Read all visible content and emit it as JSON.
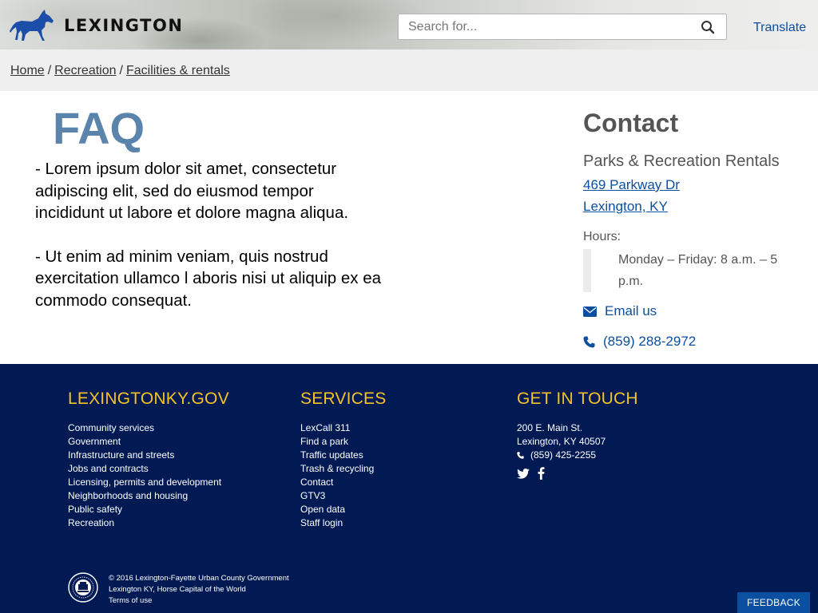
{
  "header": {
    "logo_text": "LEXINGTON",
    "search_placeholder": "Search for...",
    "translate_label": "Translate"
  },
  "breadcrumb": {
    "items": [
      "Home",
      "Recreation",
      "Facilities & rentals"
    ],
    "separator": "/"
  },
  "faq": {
    "title": "FAQ",
    "paragraphs": [
      "- Lorem ipsum dolor sit amet, consectetur adipiscing elit, sed do eiusmod tempor incididunt ut labore et dolore magna aliqua.",
      "- Ut enim ad minim veniam, quis nostrud exercitation ullamco l aboris nisi ut aliquip ex ea commodo consequat."
    ]
  },
  "contact": {
    "title": "Contact",
    "org": "Parks & Recreation Rentals",
    "address_line1": "469 Parkway Dr",
    "address_line2": "Lexington, KY",
    "hours_label": "Hours:",
    "hours_value": "Monday – Friday: 8 a.m. – 5 p.m.",
    "email_label": "Email us",
    "phone": "(859) 288-2972"
  },
  "footer": {
    "col1": {
      "heading": "LEXINGTONKY.GOV",
      "links": [
        "Community services",
        "Government",
        "Infrastructure and streets",
        "Jobs and contracts",
        "Licensing, permits and development",
        "Neighborhoods and housing",
        "Public safety",
        "Recreation"
      ]
    },
    "col2": {
      "heading": "SERVICES",
      "links": [
        "LexCall 311",
        "Find a park",
        "Traffic updates",
        "Trash & recycling",
        "Contact",
        "GTV3",
        "Open data",
        "Staff login"
      ]
    },
    "col3": {
      "heading": "GET IN TOUCH",
      "address_line1": "200 E. Main St.",
      "address_line2": "Lexington, KY 40507",
      "phone": "(859) 425-2255"
    },
    "copyright_line1": "© 2016 Lexington-Fayette Urban County Government",
    "copyright_line2": "Lexington KY, Horse Capital of the World",
    "terms_label": "Terms of use",
    "feedback_label": "FEEDBACK"
  },
  "colors": {
    "footer_bg": "#021a54",
    "footer_heading": "#f5c327",
    "link_blue": "#0b4fa0",
    "faq_title": "#5b84ad",
    "horse_blue": "#1a4ea8"
  }
}
